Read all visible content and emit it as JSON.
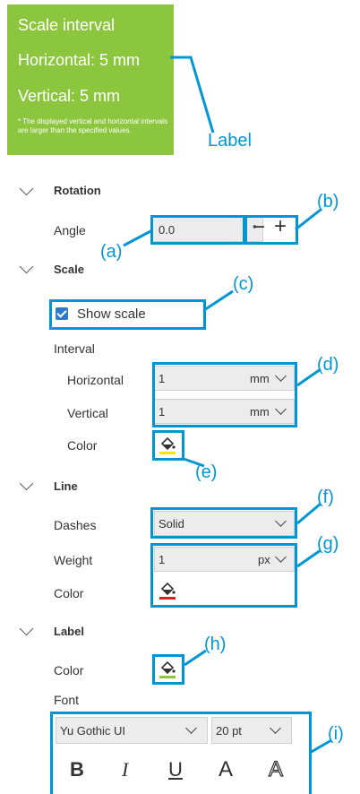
{
  "preview": {
    "title": "Scale interval",
    "horizontal": "Horizontal: 5 mm",
    "vertical": "Vertical: 5 mm",
    "note": "* The displayed vertical and horizontal intervals are larger than the specified values."
  },
  "callouts": {
    "label": "Label",
    "a": "(a)",
    "b": "(b)",
    "c": "(c)",
    "d": "(d)",
    "e": "(e)",
    "f": "(f)",
    "g": "(g)",
    "h": "(h)",
    "i": "(i)"
  },
  "rotation": {
    "header": "Rotation",
    "angle_label": "Angle",
    "angle_value": "0.0",
    "degree_symbol": "°",
    "minus": "−",
    "plus": "+"
  },
  "scale": {
    "header": "Scale",
    "show_scale_label": "Show scale",
    "show_scale_checked": true,
    "interval_label": "Interval",
    "horizontal_label": "Horizontal",
    "horizontal_value": "1",
    "horizontal_unit": "mm",
    "vertical_label": "Vertical",
    "vertical_value": "1",
    "vertical_unit": "mm",
    "color_label": "Color",
    "color": "#f5e400"
  },
  "line": {
    "header": "Line",
    "dashes_label": "Dashes",
    "dashes_value": "Solid",
    "weight_label": "Weight",
    "weight_value": "1",
    "weight_unit": "px",
    "color_label": "Color",
    "color": "#d42020"
  },
  "label_section": {
    "header": "Label",
    "color_label": "Color",
    "color": "#8cc63f",
    "font_label": "Font",
    "font_value": "Yu Gothic UI",
    "size_value": "20 pt",
    "bold": "B",
    "italic": "I",
    "underline": "U",
    "text": "A",
    "outline": "A"
  },
  "colors": {
    "accent": "#0096d6",
    "preview_bg": "#8cc63f"
  }
}
